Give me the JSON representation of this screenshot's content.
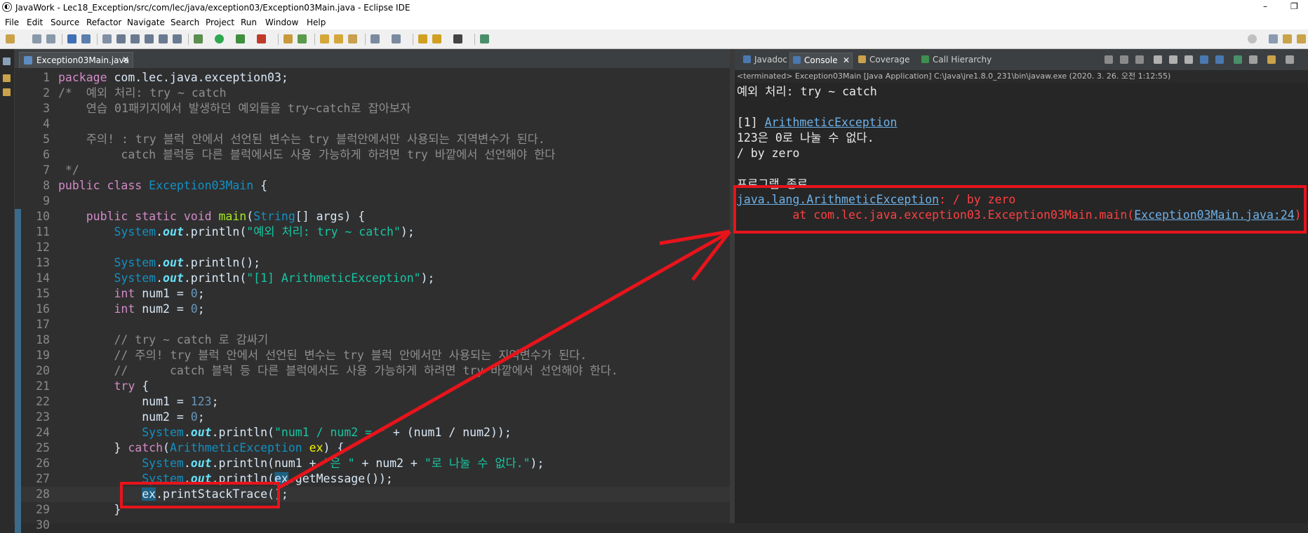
{
  "window": {
    "title": "JavaWork - Lec18_Exception/src/com/lec/java/exception03/Exception03Main.java - Eclipse IDE",
    "minimize": "–",
    "restore": "❐"
  },
  "menu": [
    "File",
    "Edit",
    "Source",
    "Refactor",
    "Navigate",
    "Search",
    "Project",
    "Run",
    "Window",
    "Help"
  ],
  "editor": {
    "tab_label": "Exception03Main.java",
    "tab_close": "✕",
    "lines": [
      {
        "n": "1",
        "mark": false,
        "cur": false,
        "tokens": [
          [
            "kw",
            "package"
          ],
          [
            "pl",
            " com.lec.java.exception03;"
          ]
        ]
      },
      {
        "n": "2",
        "mark": false,
        "cur": false,
        "tokens": [
          [
            "cm",
            "/*  예외 처리: try ~ catch"
          ]
        ]
      },
      {
        "n": "3",
        "mark": false,
        "cur": false,
        "tokens": [
          [
            "cm",
            "    연습 01패키지에서 발생하던 예외들을 try~catch로 잡아보자"
          ]
        ]
      },
      {
        "n": "4",
        "mark": false,
        "cur": false,
        "tokens": []
      },
      {
        "n": "5",
        "mark": false,
        "cur": false,
        "tokens": [
          [
            "cm",
            "    주의! : try 블럭 안에서 선언된 변수는 try 블럭안에서만 사용되는 지역변수가 된다."
          ]
        ]
      },
      {
        "n": "6",
        "mark": false,
        "cur": false,
        "tokens": [
          [
            "cm",
            "         catch 블럭등 다른 블럭에서도 사용 가능하게 하려면 try 바깥에서 선언해야 한다"
          ]
        ]
      },
      {
        "n": "7",
        "mark": false,
        "cur": false,
        "tokens": [
          [
            "cm",
            " */"
          ]
        ]
      },
      {
        "n": "8",
        "mark": false,
        "cur": false,
        "tokens": [
          [
            "kw",
            "public class "
          ],
          [
            "ty",
            "Exception03Main"
          ],
          [
            "pl",
            " {"
          ]
        ]
      },
      {
        "n": "9",
        "mark": false,
        "cur": false,
        "tokens": []
      },
      {
        "n": "10",
        "mark": true,
        "cur": false,
        "tokens": [
          [
            "pl",
            "    "
          ],
          [
            "kw",
            "public static void "
          ],
          [
            "mt",
            "main"
          ],
          [
            "pl",
            "("
          ],
          [
            "ty",
            "String"
          ],
          [
            "pl",
            "[] args) {"
          ]
        ]
      },
      {
        "n": "11",
        "mark": true,
        "cur": false,
        "tokens": [
          [
            "pl",
            "        "
          ],
          [
            "ty",
            "System"
          ],
          [
            "pl",
            "."
          ],
          [
            "fl",
            "out"
          ],
          [
            "pl",
            ".println("
          ],
          [
            "str",
            "\"예외 처리: try ~ catch\""
          ],
          [
            "pl",
            ");"
          ]
        ]
      },
      {
        "n": "12",
        "mark": true,
        "cur": false,
        "tokens": []
      },
      {
        "n": "13",
        "mark": true,
        "cur": false,
        "tokens": [
          [
            "pl",
            "        "
          ],
          [
            "ty",
            "System"
          ],
          [
            "pl",
            "."
          ],
          [
            "fl",
            "out"
          ],
          [
            "pl",
            ".println();"
          ]
        ]
      },
      {
        "n": "14",
        "mark": true,
        "cur": false,
        "tokens": [
          [
            "pl",
            "        "
          ],
          [
            "ty",
            "System"
          ],
          [
            "pl",
            "."
          ],
          [
            "fl",
            "out"
          ],
          [
            "pl",
            ".println("
          ],
          [
            "str",
            "\"[1] ArithmeticException\""
          ],
          [
            "pl",
            ");"
          ]
        ]
      },
      {
        "n": "15",
        "mark": true,
        "cur": false,
        "tokens": [
          [
            "pl",
            "        "
          ],
          [
            "kw",
            "int"
          ],
          [
            "pl",
            " num1 = "
          ],
          [
            "num",
            "0"
          ],
          [
            "pl",
            ";"
          ]
        ]
      },
      {
        "n": "16",
        "mark": true,
        "cur": false,
        "tokens": [
          [
            "pl",
            "        "
          ],
          [
            "kw",
            "int"
          ],
          [
            "pl",
            " num2 = "
          ],
          [
            "num",
            "0"
          ],
          [
            "pl",
            ";"
          ]
        ]
      },
      {
        "n": "17",
        "mark": true,
        "cur": false,
        "tokens": []
      },
      {
        "n": "18",
        "mark": true,
        "cur": false,
        "tokens": [
          [
            "cm",
            "        // try ~ catch 로 감싸기"
          ]
        ]
      },
      {
        "n": "19",
        "mark": true,
        "cur": false,
        "tokens": [
          [
            "cm",
            "        // 주의! try 블럭 안에서 선언된 변수는 try 블럭 안에서만 사용되는 지역변수가 된다."
          ]
        ]
      },
      {
        "n": "20",
        "mark": true,
        "cur": false,
        "tokens": [
          [
            "cm",
            "        //      catch 블럭 등 다른 블럭에서도 사용 가능하게 하려면 try 바깥에서 선언해야 한다."
          ]
        ]
      },
      {
        "n": "21",
        "mark": true,
        "cur": false,
        "tokens": [
          [
            "pl",
            "        "
          ],
          [
            "kw",
            "try"
          ],
          [
            "pl",
            " {"
          ]
        ]
      },
      {
        "n": "22",
        "mark": true,
        "cur": false,
        "tokens": [
          [
            "pl",
            "            num1 = "
          ],
          [
            "num",
            "123"
          ],
          [
            "pl",
            ";"
          ]
        ]
      },
      {
        "n": "23",
        "mark": true,
        "cur": false,
        "tokens": [
          [
            "pl",
            "            num2 = "
          ],
          [
            "num",
            "0"
          ],
          [
            "pl",
            ";"
          ]
        ]
      },
      {
        "n": "24",
        "mark": true,
        "cur": false,
        "tokens": [
          [
            "pl",
            "            "
          ],
          [
            "ty",
            "System"
          ],
          [
            "pl",
            "."
          ],
          [
            "fl",
            "out"
          ],
          [
            "pl",
            ".println("
          ],
          [
            "str",
            "\"num1 / num2 = \""
          ],
          [
            "pl",
            " + (num1 / num2));"
          ]
        ]
      },
      {
        "n": "25",
        "mark": true,
        "cur": false,
        "tokens": [
          [
            "pl",
            "        } "
          ],
          [
            "kw",
            "catch"
          ],
          [
            "pl",
            "("
          ],
          [
            "ty",
            "ArithmeticException"
          ],
          [
            "pl",
            " "
          ],
          [
            "vr",
            "ex"
          ],
          [
            "pl",
            ") {"
          ]
        ]
      },
      {
        "n": "26",
        "mark": true,
        "cur": false,
        "tokens": [
          [
            "pl",
            "            "
          ],
          [
            "ty",
            "System"
          ],
          [
            "pl",
            "."
          ],
          [
            "fl",
            "out"
          ],
          [
            "pl",
            ".println(num1 + "
          ],
          [
            "str",
            "\"은 \""
          ],
          [
            "pl",
            " + num2 + "
          ],
          [
            "str",
            "\"로 나눌 수 없다.\""
          ],
          [
            "pl",
            ");"
          ]
        ]
      },
      {
        "n": "27",
        "mark": true,
        "cur": false,
        "tokens": [
          [
            "pl",
            "            "
          ],
          [
            "ty",
            "System"
          ],
          [
            "pl",
            "."
          ],
          [
            "fl",
            "out"
          ],
          [
            "pl",
            ".println("
          ],
          [
            "hl",
            "ex"
          ],
          [
            "pl",
            ".getMessage());"
          ]
        ]
      },
      {
        "n": "28",
        "mark": true,
        "cur": true,
        "tokens": [
          [
            "pl",
            "            "
          ],
          [
            "hl",
            "ex"
          ],
          [
            "pl",
            ".printStackTrace();"
          ]
        ]
      },
      {
        "n": "29",
        "mark": true,
        "cur": false,
        "tokens": [
          [
            "pl",
            "        }"
          ]
        ]
      },
      {
        "n": "30",
        "mark": true,
        "cur": false,
        "tokens": []
      }
    ]
  },
  "console_view": {
    "tabs": [
      "Javadoc",
      "Console",
      "Coverage",
      "Call Hierarchy"
    ],
    "tab_close": "✕",
    "status": "<terminated> Exception03Main [Java Application] C:\\Java\\jre1.8.0_231\\bin\\javaw.exe (2020. 3. 26. 오전 1:12:55)",
    "lines": [
      {
        "segs": [
          [
            "plain",
            "예외 처리: try ~ catch"
          ]
        ]
      },
      {
        "segs": []
      },
      {
        "segs": [
          [
            "plain",
            "[1] "
          ],
          [
            "link",
            "ArithmeticException"
          ]
        ]
      },
      {
        "segs": [
          [
            "plain",
            "123은 0로 나눌 수 없다."
          ]
        ]
      },
      {
        "segs": [
          [
            "plain",
            "/ by zero"
          ]
        ]
      },
      {
        "segs": []
      },
      {
        "segs": [
          [
            "plain",
            "프로그램 종료"
          ]
        ]
      },
      {
        "segs": [
          [
            "link",
            "java.lang.ArithmeticException"
          ],
          [
            "err",
            ": / by zero"
          ]
        ]
      },
      {
        "segs": [
          [
            "err",
            "        at com.lec.java.exception03.Exception03Main.main("
          ],
          [
            "link",
            "Exception03Main.java:24"
          ],
          [
            "err",
            ")"
          ]
        ]
      }
    ]
  },
  "colors": {
    "annotation": "#e8141b",
    "editor_bg": "#2f2f2f",
    "console_bg": "#262626",
    "keyword": "#d38bc8",
    "string": "#17c6a3",
    "type": "#1290c3",
    "error": "#ff4040",
    "link": "#6eb1e8"
  }
}
